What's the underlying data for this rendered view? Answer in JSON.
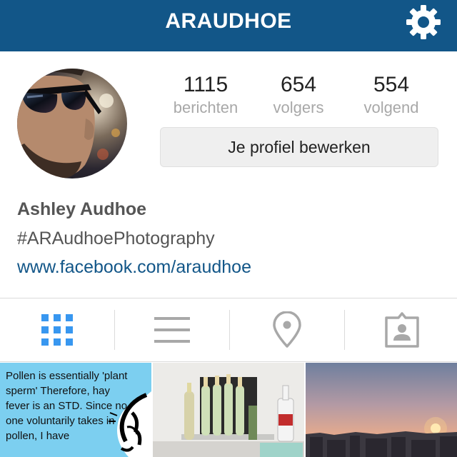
{
  "header": {
    "title": "ARAUDHOE",
    "settings_icon": "gear-icon",
    "background_color": "#125688"
  },
  "profile": {
    "avatar_icon": "avatar",
    "stats": [
      {
        "value": "1115",
        "label": "berichten"
      },
      {
        "value": "654",
        "label": "volgers"
      },
      {
        "value": "554",
        "label": "volgend"
      }
    ],
    "edit_button_label": "Je profiel bewerken",
    "name": "Ashley Audhoe",
    "bio": "#ARAudhoePhotography",
    "website": "www.facebook.com/araudhoe"
  },
  "tabs": [
    {
      "name": "grid-view",
      "icon": "grid-icon",
      "active": true
    },
    {
      "name": "list-view",
      "icon": "list-icon",
      "active": false
    },
    {
      "name": "places-view",
      "icon": "location-pin-icon",
      "active": false
    },
    {
      "name": "tagged-view",
      "icon": "tagged-person-icon",
      "active": false
    }
  ],
  "posts": [
    {
      "type": "text-quote",
      "text": "Pollen is essentially 'plant sperm' Therefore, hay fever is an STD.  Since no one voluntarily takes in pollen, I have"
    },
    {
      "type": "photo",
      "subject": "bottles"
    },
    {
      "type": "photo",
      "subject": "sunset skyline"
    }
  ],
  "colors": {
    "accent": "#125688",
    "active_tab": "#3897f0",
    "inactive_tab": "#a8a8a8",
    "button_bg": "#efefef"
  }
}
